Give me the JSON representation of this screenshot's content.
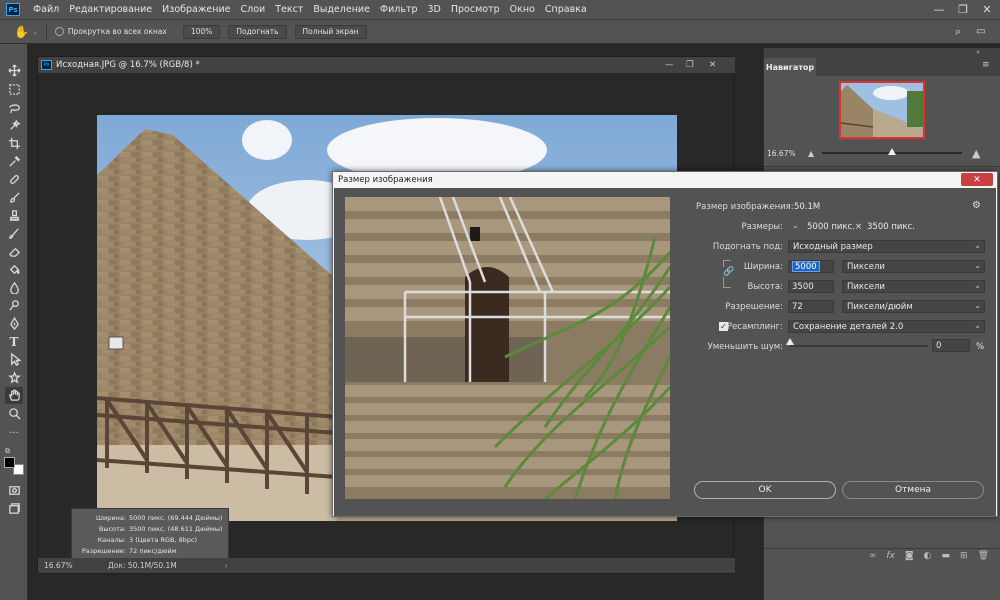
{
  "menubar": {
    "items": [
      "Файл",
      "Редактирование",
      "Изображение",
      "Слои",
      "Текст",
      "Выделение",
      "Фильтр",
      "3D",
      "Просмотр",
      "Окно",
      "Справка"
    ],
    "logo": "Ps"
  },
  "options": {
    "scroll_all": "Прокрутка во всех окнах",
    "zoom_100": "100%",
    "fit": "Подогнать",
    "fullscreen": "Полный экран"
  },
  "document": {
    "tab_title": "Исходная.JPG @ 16.7% (RGB/8) *",
    "zoom": "16.67%",
    "doc_size": "Док: 50.1M/50.1M",
    "info": {
      "width_k": "Ширина:",
      "width_v": "5000 пикс. (69.444 Дюймы)",
      "height_k": "Высота:",
      "height_v": "3500 пикс. (48.611 Дюймы)",
      "channels_k": "Каналы:",
      "channels_v": "3 (Цвета RGB, 8bpc)",
      "res_k": "Разрешение:",
      "res_v": "72 пикс/дюйм"
    }
  },
  "navigator": {
    "tab": "Навигатор",
    "zoom": "16.67%",
    "zoom_fraction": 0.5
  },
  "dialog": {
    "title": "Размер изображения",
    "image_size_label": "Размер изображения:",
    "image_size_value": "50.1M",
    "dimensions_label": "Размеры:",
    "dimensions_w": "5000 пикс.",
    "dimensions_x": "×",
    "dimensions_h": "3500 пикс.",
    "fit_label": "Подогнать под:",
    "fit_value": "Исходный размер",
    "width_label": "Ширина:",
    "width_value": "5000",
    "width_unit": "Пиксели",
    "height_label": "Высота:",
    "height_value": "3500",
    "height_unit": "Пиксели",
    "resolution_label": "Разрешение:",
    "resolution_value": "72",
    "resolution_unit": "Пиксели/дюйм",
    "resample_label": "Ресамплинг:",
    "resample_value": "Сохранение деталей 2.0",
    "noise_label": "Уменьшить шум:",
    "noise_value": "0",
    "noise_unit": "%",
    "ok": "OK",
    "cancel": "Отмена"
  },
  "colors": {
    "accent": "#31a8ff",
    "close_red": "#c84040",
    "nav_frame": "#e03030",
    "selection": "#1f66c2"
  }
}
